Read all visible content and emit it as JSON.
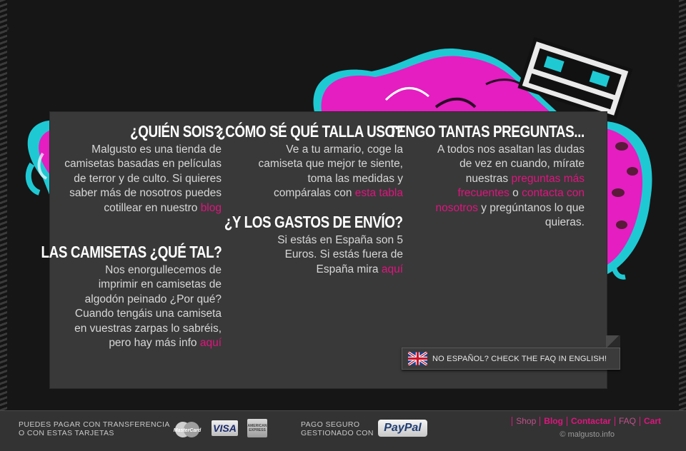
{
  "colors": {
    "accent": "#e0147f",
    "panel": "#393939",
    "footer": "#333333",
    "artwork_pink": "#e41ec1",
    "artwork_cyan": "#1fc9d3"
  },
  "sections": {
    "who": {
      "title": "¿QUIÉN SOIS?",
      "text": "Malgusto es una tienda de camisetas basadas en películas de terror y de culto. Si quieres saber más de nosotros puedes cotillear en nuestro ",
      "link": "blog"
    },
    "shirts": {
      "title": "LAS CAMISETAS ¿QUÉ TAL?",
      "text": "Nos enorgullecemos de imprimir en camisetas de algodón peinado ¿Por qué? Cuando tengáis una camiseta en vuestras zarpas lo sabréis, pero hay más info ",
      "link": "aquí"
    },
    "size": {
      "title": "¿CÓMO SÉ QUÉ TALLA USO?",
      "text": "Ve a tu armario, coge la camiseta que mejor te siente, toma las medidas y compáralas con ",
      "link": "esta tabla"
    },
    "shipping": {
      "title": "¿Y LOS GASTOS DE ENVÍO?",
      "text": "Si estás en España son 5 Euros. Si estás fuera de España mira ",
      "link": "aquí"
    },
    "questions": {
      "title": "TENGO TANTAS PREGUNTAS...",
      "text_before": "A todos nos asaltan las dudas de vez en cuando, mírate nuestras ",
      "link_faq": "preguntas más frecuentes",
      "text_middle": " o ",
      "link_contact": "contacta con nosotros",
      "text_after": " y pregúntanos lo que quieras."
    }
  },
  "english_button": {
    "label": "NO ESPAÑOL? CHECK THE FAQ IN ENGLISH!",
    "icon": "uk-flag-icon"
  },
  "footer": {
    "payment_text_line1": "PUEDES PAGAR CON TRANSFERENCIA",
    "payment_text_line2": "O CON ESTAS TARJETAS",
    "cards": [
      "MasterCard",
      "VISA",
      "AMERICAN EXPRESS"
    ],
    "secure_text_line1": "PAGO SEGURO",
    "secure_text_line2": "GESTIONADO CON",
    "paypal": "PayPal",
    "nav": [
      "Shop",
      "Blog",
      "Contactar",
      "FAQ",
      "Cart"
    ],
    "copyright": "© malgusto.info"
  }
}
